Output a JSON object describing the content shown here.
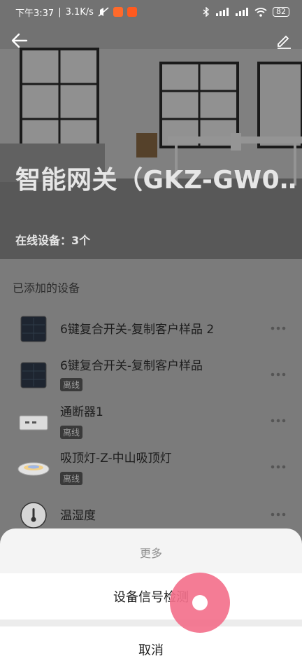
{
  "status_bar": {
    "time": "下午3:37",
    "speed": "3.1K/s",
    "battery": "82"
  },
  "header": {
    "title": "智能网关（GKZ-GW0…",
    "online_label": "在线设备：3个",
    "back_icon": "arrow-left-icon",
    "edit_icon": "pencil-icon"
  },
  "section": {
    "title": "已添加的设备"
  },
  "devices": [
    {
      "name": "6键复合开关-复制客户样品 2",
      "status": "",
      "icon": "switch-panel-icon"
    },
    {
      "name": "6键复合开关-复制客户样品",
      "status": "离线",
      "icon": "switch-panel-icon"
    },
    {
      "name": "通断器1",
      "status": "离线",
      "icon": "relay-module-icon"
    },
    {
      "name": "吸顶灯-Z-中山吸顶灯",
      "status": "离线",
      "icon": "ceiling-light-icon"
    },
    {
      "name": "温湿度",
      "status": "",
      "icon": "thermometer-icon"
    }
  ],
  "sheet": {
    "title": "更多",
    "option": "设备信号检测",
    "cancel": "取消"
  }
}
